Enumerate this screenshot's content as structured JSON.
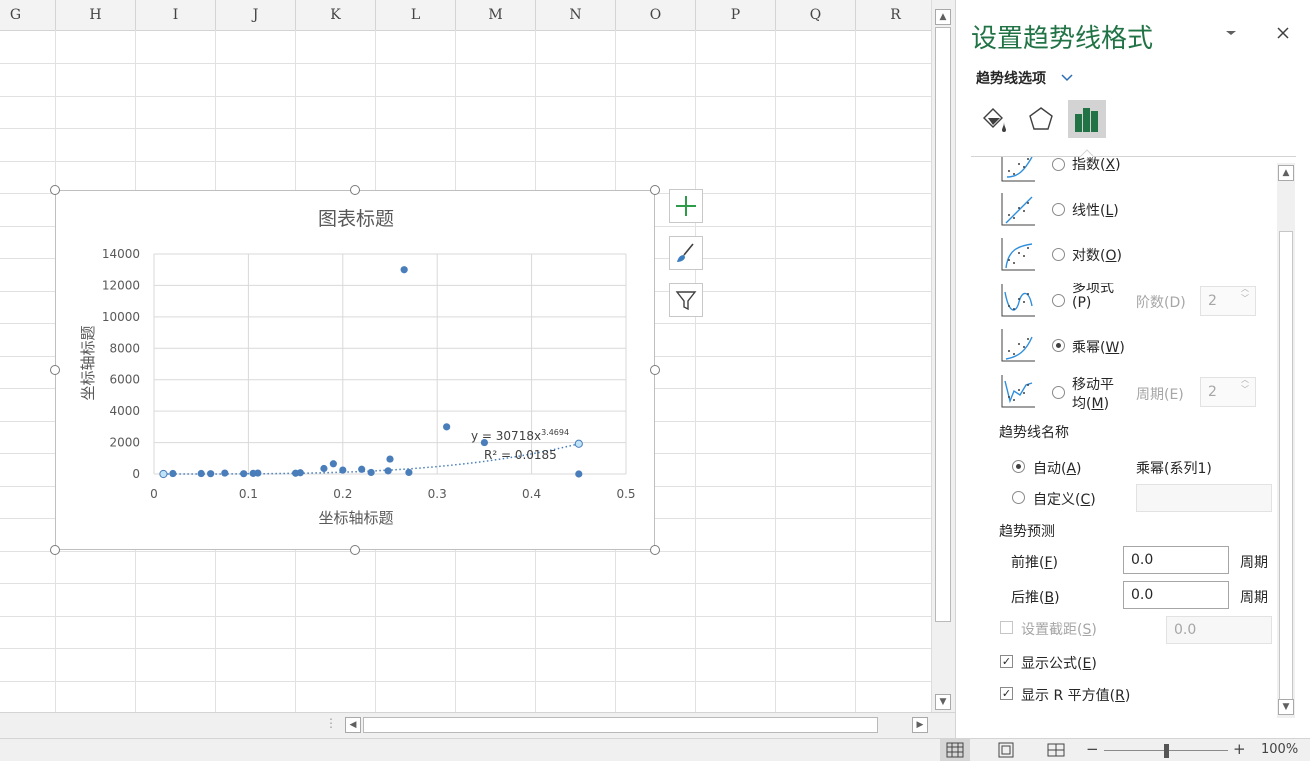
{
  "sheet": {
    "columns": [
      "G",
      "H",
      "I",
      "J",
      "K",
      "L",
      "M",
      "N",
      "O",
      "P",
      "Q",
      "R"
    ]
  },
  "chart": {
    "buttons": [
      "plus-icon",
      "brush-icon",
      "filter-icon"
    ]
  },
  "chart_data": {
    "type": "scatter",
    "title": "图表标题",
    "xlabel": "坐标轴标题",
    "ylabel": "坐标轴标题",
    "xlim": [
      0,
      0.5
    ],
    "ylim": [
      0,
      14000
    ],
    "x_ticks": [
      "0",
      "0.1",
      "0.2",
      "0.3",
      "0.4",
      "0.5"
    ],
    "y_ticks": [
      "0",
      "2000",
      "4000",
      "6000",
      "8000",
      "10000",
      "12000",
      "14000"
    ],
    "grid": true,
    "series": [
      {
        "color": "#4a7ebb",
        "points": [
          [
            0.01,
            20
          ],
          [
            0.02,
            30
          ],
          [
            0.05,
            30
          ],
          [
            0.06,
            20
          ],
          [
            0.075,
            60
          ],
          [
            0.095,
            20
          ],
          [
            0.105,
            40
          ],
          [
            0.11,
            60
          ],
          [
            0.15,
            50
          ],
          [
            0.155,
            80
          ],
          [
            0.18,
            350
          ],
          [
            0.19,
            650
          ],
          [
            0.2,
            250
          ],
          [
            0.22,
            300
          ],
          [
            0.23,
            100
          ],
          [
            0.248,
            200
          ],
          [
            0.25,
            950
          ],
          [
            0.265,
            13000
          ],
          [
            0.27,
            100
          ],
          [
            0.31,
            3000
          ],
          [
            0.35,
            2000
          ],
          [
            0.45,
            0
          ]
        ]
      }
    ],
    "trendline": {
      "type": "power",
      "coef": 30718,
      "exponent": 3.4694,
      "equation_label": "y = 30718x",
      "equation_exp": "3.4694",
      "r2_label": "R² = 0.0185"
    }
  },
  "panel": {
    "title": "设置趋势线格式",
    "dropdown_icon": "chevron-down-icon",
    "close_icon": "close-icon",
    "options_label": "趋势线选项",
    "tab_icons": [
      "fill-line-icon",
      "effects-pentagon-icon",
      "bar-chart-icon"
    ],
    "types": {
      "exponential": {
        "text": "指数(",
        "key": "X",
        "close": ")"
      },
      "linear": {
        "text": "线性(",
        "key": "L",
        "close": ")"
      },
      "log": {
        "text": "对数(",
        "key": "O",
        "close": ")"
      },
      "poly": {
        "text": "多项式",
        "line2": "(P)"
      },
      "poly_order_label": "阶数(D)",
      "poly_order_value": "2",
      "power": {
        "text": "乘幂(",
        "key": "W",
        "close": ")"
      },
      "moving_avg": {
        "line1": "移动平",
        "line2": "均(",
        "key": "M",
        "close": ")"
      },
      "period_label": "周期(E)",
      "period_value": "2"
    },
    "name_section": "趋势线名称",
    "auto_label": {
      "text": "自动(",
      "key": "A",
      "close": ")"
    },
    "auto_value": "乘幂(系列1)",
    "custom_label": {
      "text": "自定义(",
      "key": "C",
      "close": ")"
    },
    "forecast_section": "趋势预测",
    "forward": {
      "text": "前推(",
      "key": "F",
      "close": ")",
      "value": "0.0",
      "unit": "周期"
    },
    "backward": {
      "text": "后推(",
      "key": "B",
      "close": ")",
      "value": "0.0",
      "unit": "周期"
    },
    "intercept": {
      "text": "设置截距(",
      "key": "S",
      "close": ")",
      "value": "0.0"
    },
    "show_equation": {
      "text": "显示公式(",
      "key": "E",
      "close": ")"
    },
    "show_r2": {
      "text": "显示 R 平方值(",
      "key": "R",
      "close": ")"
    }
  },
  "statusbar": {
    "zoom_minus": "−",
    "zoom_plus": "+",
    "zoom_level": "100%"
  }
}
